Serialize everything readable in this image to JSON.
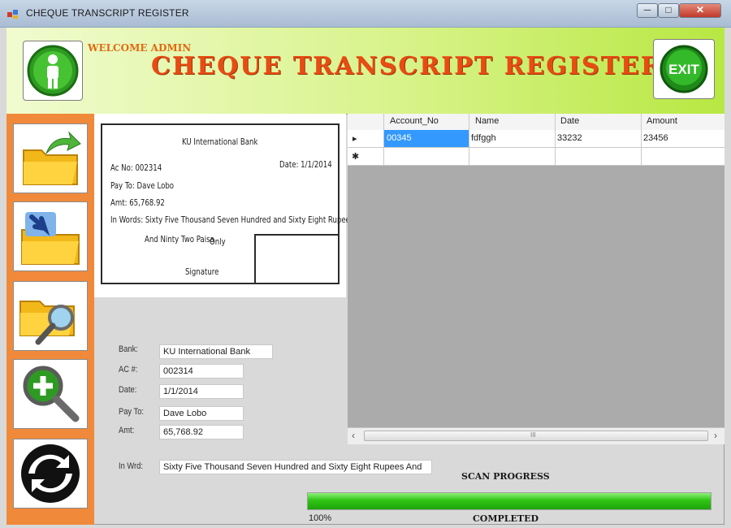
{
  "window": {
    "title": "CHEQUE TRANSCRIPT REGISTER",
    "minimize": "─",
    "maximize": "□",
    "close": "✕"
  },
  "header": {
    "welcome": "WELCOME ADMIN",
    "title": "CHEQUE TRANSCRIPT REGISTER",
    "exit_label": "EXIT"
  },
  "sidebar": {
    "buttons": [
      "open-folder",
      "import-folder",
      "search-folder",
      "add-search",
      "refresh"
    ]
  },
  "cheque": {
    "bank": "KU International Bank",
    "ac_no": "Ac No: 002314",
    "date": "Date: 1/1/2014",
    "pay_to": "Pay To: Dave Lobo",
    "amt": "Amt: 65,768.92",
    "in_words_1": "In Words: Sixty Five Thousand Seven Hundred and Sixty Eight Rupees",
    "in_words_2": "And Ninty Two Paisa",
    "only": "Only",
    "signature": "Signature"
  },
  "grid": {
    "columns": [
      "Account_No",
      "Name",
      "Date",
      "Amount"
    ],
    "rows": [
      {
        "indicator": "▸",
        "account_no": "00345",
        "name": "fdfggh",
        "date": "33232",
        "amount": "23456"
      },
      {
        "indicator": "✱",
        "account_no": "",
        "name": "",
        "date": "",
        "amount": ""
      }
    ],
    "scroll_thumb": "III",
    "scroll_left": "‹",
    "scroll_right": "›"
  },
  "form": {
    "bank_label": "Bank:",
    "bank_value": "KU International Bank",
    "ac_label": "AC #:",
    "ac_value": "002314",
    "date_label": "Date:",
    "date_value": "1/1/2014",
    "payto_label": "Pay To:",
    "payto_value": "Dave Lobo",
    "amt_label": "Amt:",
    "amt_value": "65,768.92",
    "inwrd_label": "In Wrd:",
    "inwrd_value": "Sixty Five Thousand Seven Hundred and Sixty Eight Rupees And"
  },
  "scan": {
    "label": "SCAN PROGRESS",
    "progress": 1.0,
    "percent_text": "100%",
    "status": "COMPLETED"
  },
  "colors": {
    "header_green": "#b8e842",
    "title_orange": "#e84c13",
    "sidebar_orange": "#f08a3a",
    "progress_green": "#2fc414",
    "selection_blue": "#3399ff"
  }
}
